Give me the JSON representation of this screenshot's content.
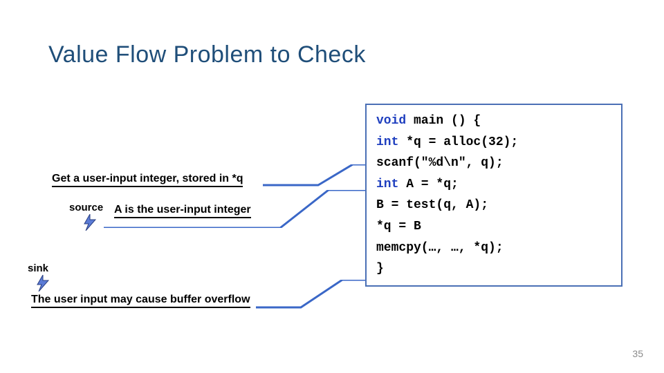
{
  "title": "Value Flow Problem to Check",
  "annotations": {
    "a1": "Get a user-input integer, stored in *q",
    "source_label": "source",
    "a2": "A is the user-input integer",
    "sink_label": "sink",
    "a3": "The user input may cause buffer overflow"
  },
  "code": {
    "l1_kw": "void",
    "l1_rest": " main () {",
    "l2_kw": "int",
    "l2_rest": " *q = alloc(32);",
    "l3": "scanf(\"%d\\n\", q);",
    "l4_kw": "int",
    "l4_rest": " A = *q;",
    "l5": "B = test(q, A);",
    "l6": "*q = B",
    "l7": "memcpy(…, …, *q);",
    "l8": "}"
  },
  "page_number": "35"
}
